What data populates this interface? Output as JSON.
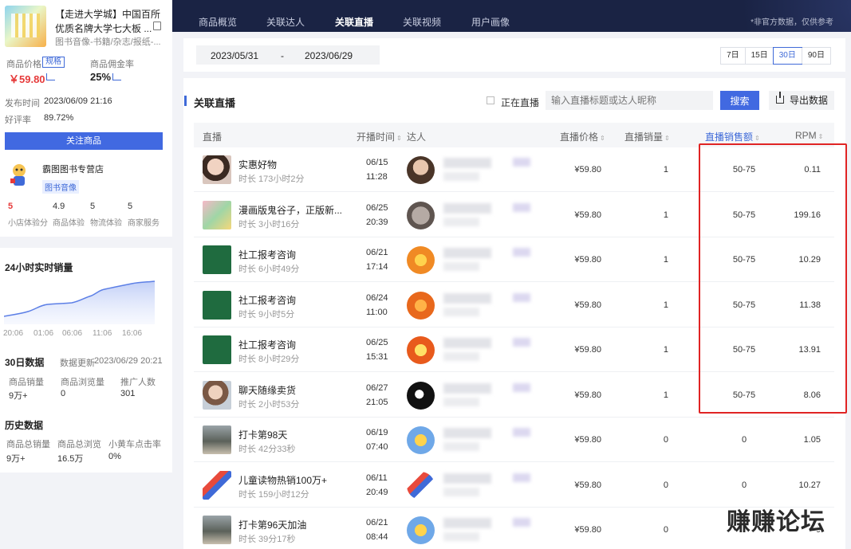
{
  "product": {
    "title": "【走进大学城】中国百所优质名牌大学七大板 ...",
    "category": "图书音像-书籍/杂志/报纸-...",
    "price_label": "商品价格",
    "spec_tag": "规格",
    "price": "￥59.80",
    "commission_label": "商品佣金率",
    "commission": "25%",
    "publish_label": "发布时间",
    "publish_time": "2023/06/09 21:16",
    "rating_label": "好评率",
    "rating": "89.72%",
    "follow_button": "关注商品"
  },
  "shop": {
    "name": "霸图图书专营店",
    "tag": "图书音像",
    "scores": [
      {
        "value": "5",
        "label": "小店体验分"
      },
      {
        "value": "4.9",
        "label": "商品体验"
      },
      {
        "value": "5",
        "label": "物流体验"
      },
      {
        "value": "5",
        "label": "商家服务"
      }
    ]
  },
  "realtime": {
    "title": "24小时实时销量",
    "ticks": [
      "20:06",
      "01:06",
      "06:06",
      "11:06",
      "16:06"
    ]
  },
  "stats30": {
    "title": "30日数据",
    "update_label": "数据更新",
    "update_time": "2023/06/29 20:21",
    "items": [
      {
        "label": "商品销量",
        "value": "9万+"
      },
      {
        "label": "商品浏览量",
        "value": "0"
      },
      {
        "label": "推广人数",
        "value": "301"
      }
    ]
  },
  "history": {
    "title": "历史数据",
    "items": [
      {
        "label": "商品总销量",
        "value": "9万+"
      },
      {
        "label": "商品总浏览",
        "value": "16.5万"
      },
      {
        "label": "小黄车点击率",
        "value": "0%"
      }
    ]
  },
  "nav": {
    "tabs": [
      "商品概览",
      "关联达人",
      "关联直播",
      "关联视频",
      "用户画像"
    ],
    "active": 2,
    "note": "*非官方数据，仅供参考"
  },
  "datebar": {
    "start": "2023/05/31",
    "sep": "-",
    "end": "2023/06/29",
    "periods": [
      "7日",
      "15日",
      "30日",
      "90日"
    ],
    "active_period": 2
  },
  "toolbar": {
    "title": "关联直播",
    "live_label": "正在直播",
    "search_placeholder": "输入直播标题或达人昵称",
    "search_button": "搜索",
    "export_button": "导出数据"
  },
  "table": {
    "headers": {
      "live": "直播",
      "start_time": "开播时间",
      "influencer": "达人",
      "price": "直播价格",
      "sales": "直播销量",
      "gmv": "直播销售额",
      "rpm": "RPM"
    },
    "sort_mark": "⇕",
    "rows": [
      {
        "title": "实惠好物",
        "duration": "时长 173小时2分",
        "date": "06/15",
        "time": "11:28",
        "price": "¥59.80",
        "sales": "1",
        "gmv": "50-75",
        "rpm": "0.11"
      },
      {
        "title": "漫画版鬼谷子，正版新...",
        "duration": "时长 3小时16分",
        "date": "06/25",
        "time": "20:39",
        "price": "¥59.80",
        "sales": "1",
        "gmv": "50-75",
        "rpm": "199.16"
      },
      {
        "title": "社工报考咨询",
        "duration": "时长 6小时49分",
        "date": "06/21",
        "time": "17:14",
        "price": "¥59.80",
        "sales": "1",
        "gmv": "50-75",
        "rpm": "10.29"
      },
      {
        "title": "社工报考咨询",
        "duration": "时长 9小时5分",
        "date": "06/24",
        "time": "11:00",
        "price": "¥59.80",
        "sales": "1",
        "gmv": "50-75",
        "rpm": "11.38"
      },
      {
        "title": "社工报考咨询",
        "duration": "时长 8小时29分",
        "date": "06/25",
        "time": "15:31",
        "price": "¥59.80",
        "sales": "1",
        "gmv": "50-75",
        "rpm": "13.91"
      },
      {
        "title": "聊天随缘卖货",
        "duration": "时长 2小时53分",
        "date": "06/27",
        "time": "21:05",
        "price": "¥59.80",
        "sales": "1",
        "gmv": "50-75",
        "rpm": "8.06"
      },
      {
        "title": "打卡第98天",
        "duration": "时长 42分33秒",
        "date": "06/19",
        "time": "07:40",
        "price": "¥59.80",
        "sales": "0",
        "gmv": "0",
        "rpm": "1.05"
      },
      {
        "title": "儿童读物热销100万+",
        "duration": "时长 159小时12分",
        "date": "06/11",
        "time": "20:49",
        "price": "¥59.80",
        "sales": "0",
        "gmv": "0",
        "rpm": "10.27"
      },
      {
        "title": "打卡第96天加油",
        "duration": "时长 39分17秒",
        "date": "06/21",
        "time": "08:44",
        "price": "¥59.80",
        "sales": "0",
        "gmv": "0",
        "rpm": "0"
      }
    ]
  },
  "colors": {
    "accent": "#4169e1",
    "nav_bg": "#1a2344",
    "price_red": "#e63a3a",
    "highlight": "#e02424"
  },
  "watermark": "赚赚论坛"
}
